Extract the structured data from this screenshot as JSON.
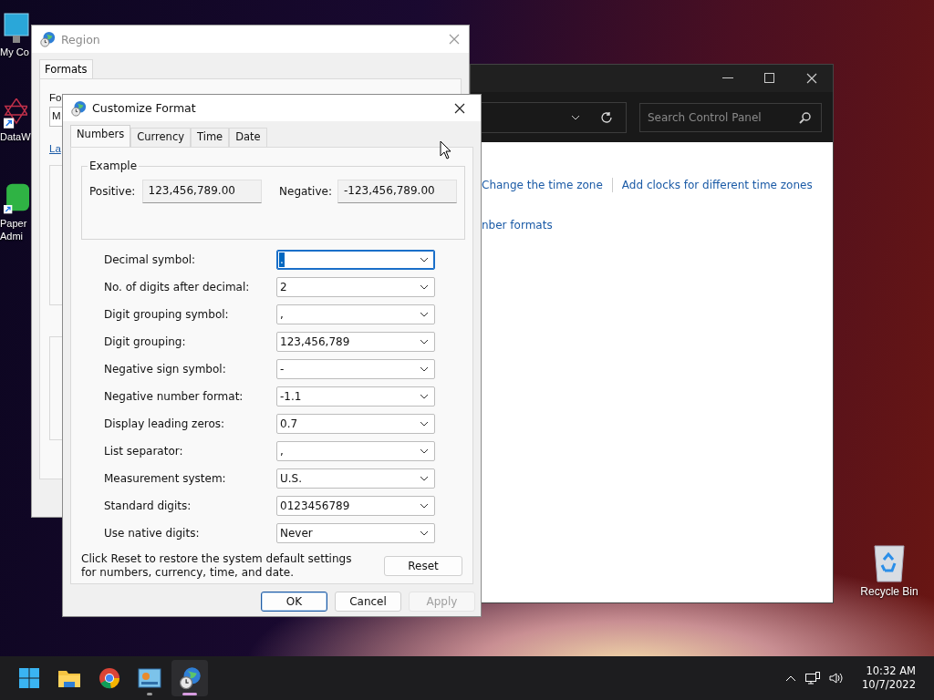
{
  "desktop_icons": [
    {
      "kind": "computer",
      "label": "My Co"
    },
    {
      "kind": "network",
      "label": "DataW"
    },
    {
      "kind": "paper",
      "label": "Paper Admi"
    },
    {
      "kind": "recycle",
      "label": "Recycle Bin"
    }
  ],
  "control_panel": {
    "search_placeholder": "Search Control Panel",
    "links": [
      "Change the time zone",
      "Add clocks for different time zones",
      "nber formats"
    ]
  },
  "region_window": {
    "title": "Region",
    "tabs": [
      "Formats"
    ],
    "format_label": "Fo",
    "format_value": "M",
    "link": "La"
  },
  "customize_format": {
    "title": "Customize Format",
    "tabs": [
      {
        "label": "Numbers",
        "selected": true
      },
      {
        "label": "Currency",
        "selected": false
      },
      {
        "label": "Time",
        "selected": false
      },
      {
        "label": "Date",
        "selected": false
      }
    ],
    "example": {
      "title": "Example",
      "positive_label": "Positive:",
      "positive_value": "123,456,789.00",
      "negative_label": "Negative:",
      "negative_value": "-123,456,789.00"
    },
    "settings": [
      {
        "label": "Decimal symbol:",
        "value": ".",
        "focused": true
      },
      {
        "label": "No. of digits after decimal:",
        "value": "2",
        "focused": false
      },
      {
        "label": "Digit grouping symbol:",
        "value": ",",
        "focused": false
      },
      {
        "label": "Digit grouping:",
        "value": "123,456,789",
        "focused": false
      },
      {
        "label": "Negative sign symbol:",
        "value": "-",
        "focused": false
      },
      {
        "label": "Negative number format:",
        "value": "-1.1",
        "focused": false
      },
      {
        "label": "Display leading zeros:",
        "value": "0.7",
        "focused": false
      },
      {
        "label": "List separator:",
        "value": ",",
        "focused": false
      },
      {
        "label": "Measurement system:",
        "value": "U.S.",
        "focused": false
      },
      {
        "label": "Standard digits:",
        "value": "0123456789",
        "focused": false
      },
      {
        "label": "Use native digits:",
        "value": "Never",
        "focused": false
      }
    ],
    "reset_note": "Click Reset to restore the system default settings for numbers, currency, time, and date.",
    "reset_button": "Reset",
    "buttons": [
      {
        "label": "OK",
        "default": true,
        "disabled": false
      },
      {
        "label": "Cancel",
        "default": false,
        "disabled": false
      },
      {
        "label": "Apply",
        "default": false,
        "disabled": true
      }
    ]
  },
  "taskbar": {
    "apps": [
      {
        "kind": "start",
        "running": false,
        "selected": false
      },
      {
        "kind": "folder",
        "running": false,
        "selected": false
      },
      {
        "kind": "browser",
        "running": false,
        "selected": false
      },
      {
        "kind": "control-panel",
        "running": true,
        "selected": false
      },
      {
        "kind": "region",
        "running": true,
        "selected": true
      }
    ],
    "time": "10:32 AM",
    "date": "10/7/2022"
  }
}
